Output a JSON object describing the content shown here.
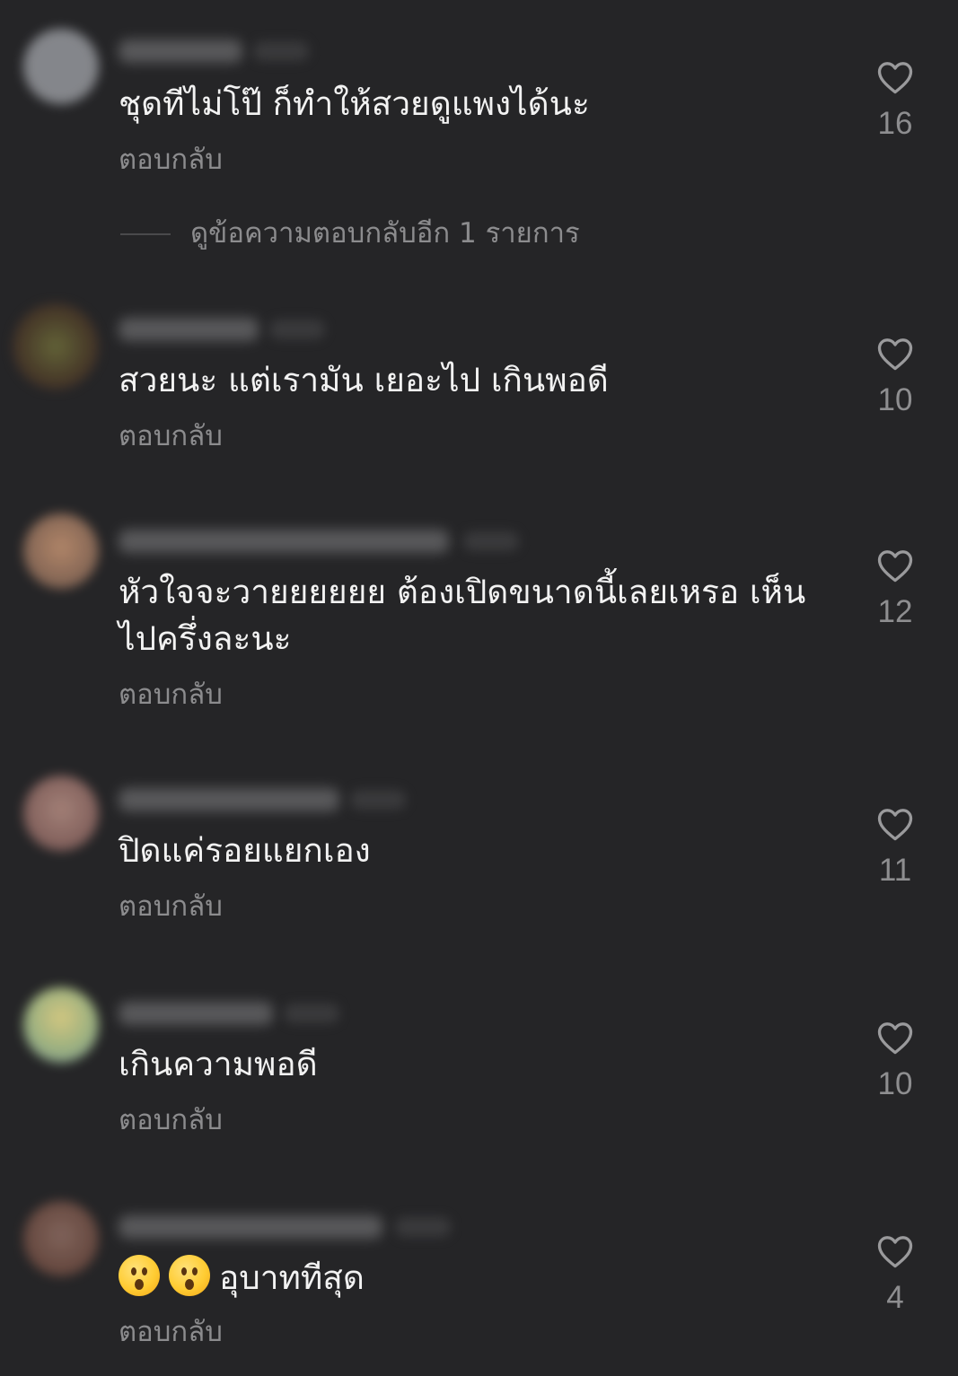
{
  "comments": [
    {
      "text": "ชุดทีไม่โป๊ ก็ทำให้สวยดูแพงได้นะ",
      "reply_label": "ตอบกลับ",
      "likes": "16",
      "avatar_color": "#8f9196"
    },
    {
      "text": "สวยนะ แต่เรามัน เยอะไป เกินพอดี",
      "reply_label": "ตอบกลับ",
      "likes": "10",
      "avatar_color": "#5a4a2a"
    },
    {
      "text": "หัวใจจะวายยยยยย ต้องเปิดขนาดนี้เลยเหรอ เห็นไปครึ่งละนะ",
      "reply_label": "ตอบกลับ",
      "likes": "12",
      "avatar_color": "#a07a63"
    },
    {
      "text": "ปิดแค่รอยแยกเอง",
      "reply_label": "ตอบกลับ",
      "likes": "11",
      "avatar_color": "#9a7670"
    },
    {
      "text": "เกินความพอดี",
      "reply_label": "ตอบกลับ",
      "likes": "10",
      "avatar_color": "#b8c28a"
    },
    {
      "emojis": [
        "hushed-face",
        "hushed-face"
      ],
      "text": "อุบาททีสุด",
      "reply_label": "ตอบกลับ",
      "likes": "4",
      "avatar_color": "#6b4a40"
    }
  ],
  "view_more_replies": "ดูข้อความตอบกลับอีก 1 รายการ",
  "icons": {
    "like": "heart-outline-icon"
  },
  "colors": {
    "background": "#252527",
    "text": "#f2f2f2",
    "muted": "#8c8c8e"
  }
}
